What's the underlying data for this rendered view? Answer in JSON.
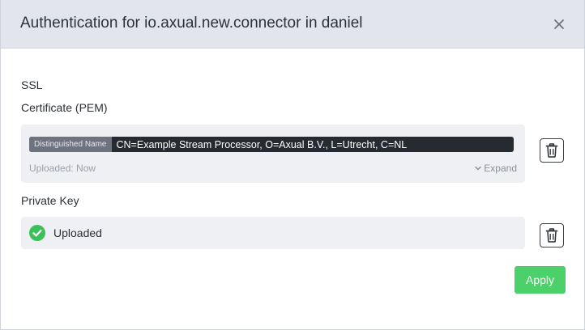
{
  "modal": {
    "title": "Authentication for io.axual.new.connector in daniel"
  },
  "ssl": {
    "heading": "SSL",
    "certificate": {
      "label": "Certificate (PEM)",
      "dn_label": "Distinguished Name",
      "dn_value": "CN=Example Stream Processor, O=Axual B.V., L=Utrecht, C=NL",
      "uploaded_text": "Uploaded: Now",
      "expand_label": "Expand"
    },
    "private_key": {
      "label": "Private Key",
      "status": "Uploaded"
    }
  },
  "actions": {
    "apply_label": "Apply"
  },
  "colors": {
    "header_bg": "#e2e5ec",
    "panel_bg": "#eef0f4",
    "dn_bar_bg": "#262a31",
    "dn_label_bg": "#6e7380",
    "success": "#3cc15a",
    "apply_bg": "#4cd06a"
  },
  "icons": {
    "close": "close-icon",
    "trash": "trash-icon",
    "check": "check-circle-icon",
    "expand": "chevron-down-icon"
  }
}
